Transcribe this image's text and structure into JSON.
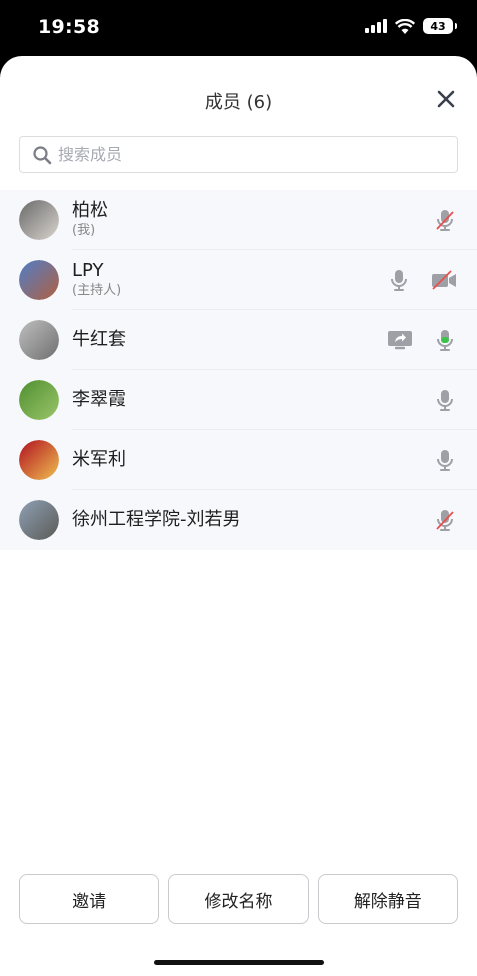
{
  "status_bar": {
    "time": "19:58",
    "battery": "43"
  },
  "header": {
    "title": "成员 (6)"
  },
  "search": {
    "placeholder": "搜索成员",
    "value": ""
  },
  "members": [
    {
      "name": "柏松",
      "role": "(我)",
      "avatar_colors": [
        "#6a6a6a",
        "#d9d4ce"
      ],
      "icons": [
        "mic-muted-icon"
      ]
    },
    {
      "name": "LPY",
      "role": "(主持人)",
      "avatar_colors": [
        "#4f7ec8",
        "#b06040"
      ],
      "icons": [
        "mic-icon",
        "camera-off-icon"
      ]
    },
    {
      "name": "牛红套",
      "role": "",
      "avatar_colors": [
        "#bfbfbf",
        "#6f6f6f"
      ],
      "icons": [
        "screen-share-icon",
        "mic-active-icon"
      ]
    },
    {
      "name": "李翠霞",
      "role": "",
      "avatar_colors": [
        "#4f8f30",
        "#9bc56a"
      ],
      "icons": [
        "mic-icon"
      ]
    },
    {
      "name": "米军利",
      "role": "",
      "avatar_colors": [
        "#b01020",
        "#f0c050"
      ],
      "icons": [
        "mic-icon"
      ]
    },
    {
      "name": "徐州工程学院-刘若男",
      "role": "",
      "avatar_colors": [
        "#8fa0b5",
        "#5a5a55"
      ],
      "icons": [
        "mic-muted-icon"
      ]
    }
  ],
  "footer": {
    "invite_label": "邀请",
    "rename_label": "修改名称",
    "unmute_label": "解除静音"
  },
  "colors": {
    "mic_gray": "#9ea0a6",
    "mic_active_green": "#3fc24a",
    "muted_slash_red": "#e85050"
  }
}
